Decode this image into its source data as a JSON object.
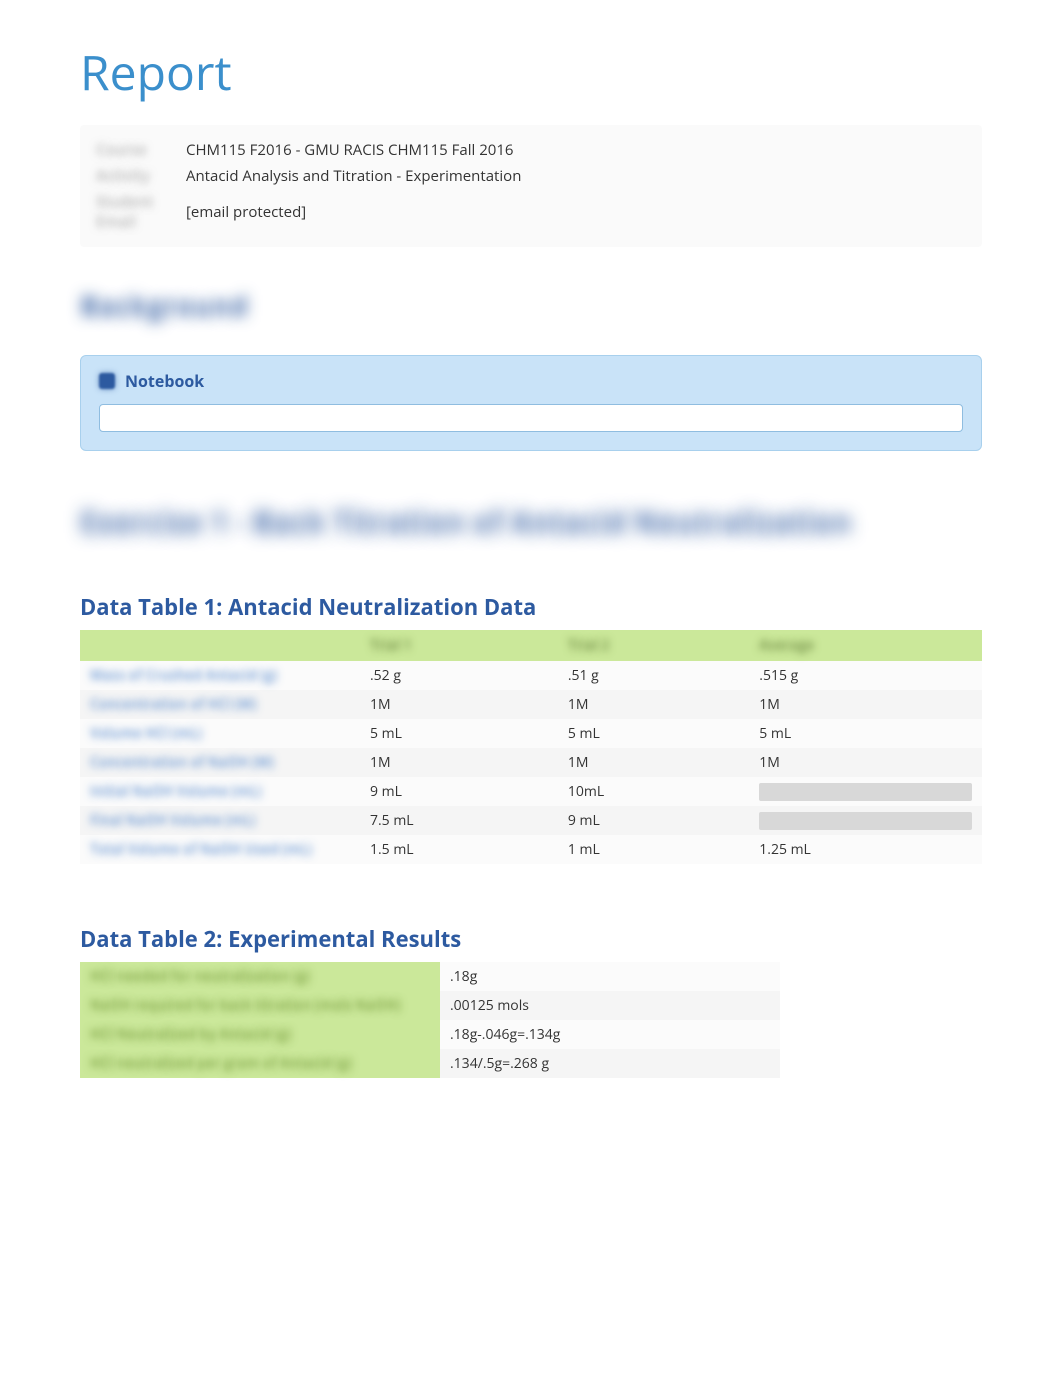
{
  "title": "Report",
  "meta": {
    "label1": "Course",
    "label2": "Activity",
    "label3": "Student Email",
    "course": "CHM115 F2016 - GMU RACIS CHM115 Fall 2016",
    "activity": "Antacid Analysis and Titration - Experimentation",
    "email": "[email protected]"
  },
  "background_heading": "Background",
  "notebook": {
    "title": "Notebook",
    "value": ""
  },
  "exercise_heading": "Exercise 1 - Back Titration of Antacid Neutralization",
  "table1": {
    "title": "Data Table 1: Antacid Neutralization Data",
    "headers": [
      "",
      "Trial 1",
      "Trial 2",
      "Average"
    ],
    "rows": [
      {
        "label": "Mass of Crushed Antacid (g)",
        "c1": ".52 g",
        "c2": ".51 g",
        "c3": ".515 g",
        "c3_grey": false
      },
      {
        "label": "Concentration of HCl (M)",
        "c1": "1M",
        "c2": "1M",
        "c3": "1M",
        "c3_grey": false
      },
      {
        "label": "Volume HCl (mL)",
        "c1": "5 mL",
        "c2": "5 mL",
        "c3": "5 mL",
        "c3_grey": false
      },
      {
        "label": "Concentration of NaOH (M)",
        "c1": "1M",
        "c2": "1M",
        "c3": "1M",
        "c3_grey": false
      },
      {
        "label": "Initial NaOH Volume (mL)",
        "c1": "9 mL",
        "c2": "10mL",
        "c3": "",
        "c3_grey": true
      },
      {
        "label": "Final NaOH Volume (mL)",
        "c1": "7.5 mL",
        "c2": "9 mL",
        "c3": "",
        "c3_grey": true
      },
      {
        "label": "Total Volume of NaOH Used (mL)",
        "c1": "1.5 mL",
        "c2": "1 mL",
        "c3": "1.25 mL",
        "c3_grey": false
      }
    ]
  },
  "table2": {
    "title": "Data Table 2: Experimental Results",
    "rows": [
      {
        "label": "HCl needed for neutralization (g)",
        "value": ".18g"
      },
      {
        "label": "NaOH required for back titration (mols NaOH)",
        "value": ".00125 mols"
      },
      {
        "label": "HCl Neutralized by Antacid (g)",
        "value": ".18g-.046g=.134g"
      },
      {
        "label": "HCl neutralized per gram of Antacid (g)",
        "value": ".134/.5g=.268 g"
      }
    ]
  }
}
